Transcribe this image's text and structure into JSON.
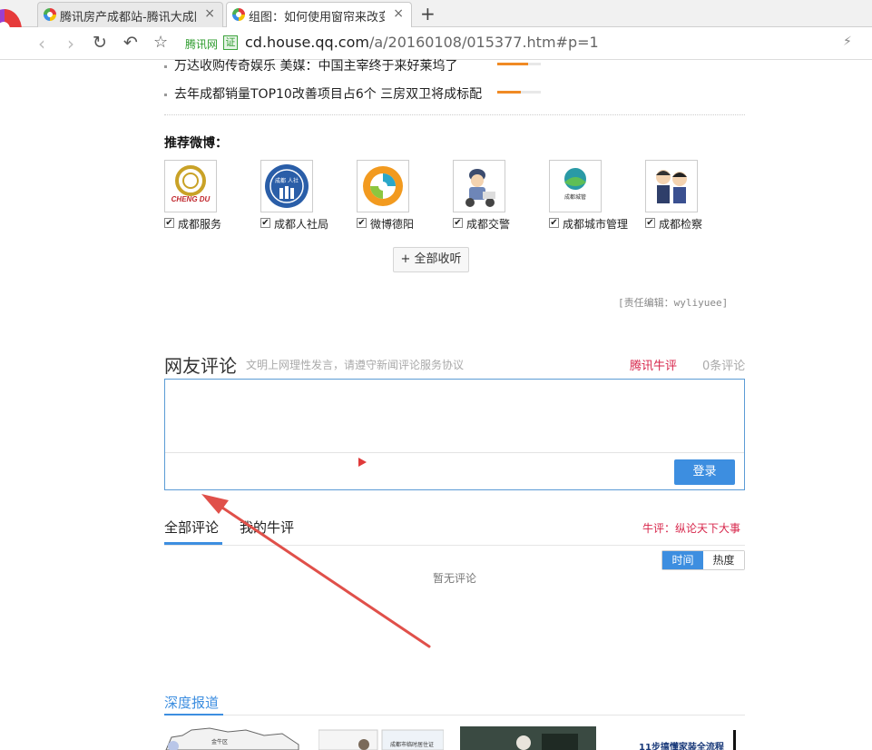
{
  "browser": {
    "tabs": [
      {
        "label": "腾讯房产成都站-腾讯大成网",
        "close": "×"
      },
      {
        "label": "组图：如何使用窗帘来改变房",
        "close": "×"
      }
    ],
    "new_tab": "+",
    "site_name": "腾讯网",
    "verify_badge": "证",
    "url_host": "cd.house.qq.com",
    "url_path": "/a/20160108/015377.htm#p=1"
  },
  "news_list": [
    {
      "title": "万达收购传奇娱乐 美媒：中国主宰终于来好莱坞了",
      "heat": 0.7
    },
    {
      "title": "去年成都销量TOP10改善项目占6个 三房双卫将成标配",
      "heat": 0.55
    }
  ],
  "weibo": {
    "title": "推荐微博：",
    "accounts": [
      {
        "name": "成都服务",
        "checked": true,
        "avatar_text": "CHENG DU"
      },
      {
        "name": "成都人社局",
        "checked": true,
        "avatar_text": "成都 人社"
      },
      {
        "name": "微博德阳",
        "checked": true,
        "avatar_text": ""
      },
      {
        "name": "成都交警",
        "checked": true,
        "avatar_text": ""
      },
      {
        "name": "成都城市管理",
        "checked": true,
        "avatar_text": "成都城管"
      },
      {
        "name": "成都检察",
        "checked": true,
        "avatar_text": ""
      }
    ],
    "follow_all": "+ 全部收听"
  },
  "editor": "[责任编辑：wyliyuee]",
  "comments": {
    "title": "网友评论",
    "tip": "文明上网理性发言，请遵守新闻评论服务协议",
    "brand": "腾讯牛评",
    "count": "0条评论",
    "login": "登录",
    "tab_all": "全部评论",
    "tab_mine": "我的牛评",
    "slogan": "牛评：纵论天下大事",
    "sort_time": "时间",
    "sort_hot": "热度",
    "empty": "暂无评论"
  },
  "deep": {
    "title": "深度报道",
    "thumbs": [
      {
        "caption": "金牛区"
      },
      {
        "caption": "成都市临时居住证"
      },
      {
        "caption": ""
      },
      {
        "caption": "11步搞懂家装全流程"
      }
    ]
  },
  "colors": {
    "accent": "#3d8ee0",
    "brand_red": "#d7264b",
    "heat_orange": "#f08a24",
    "annotation_arrow": "#e0504a"
  }
}
